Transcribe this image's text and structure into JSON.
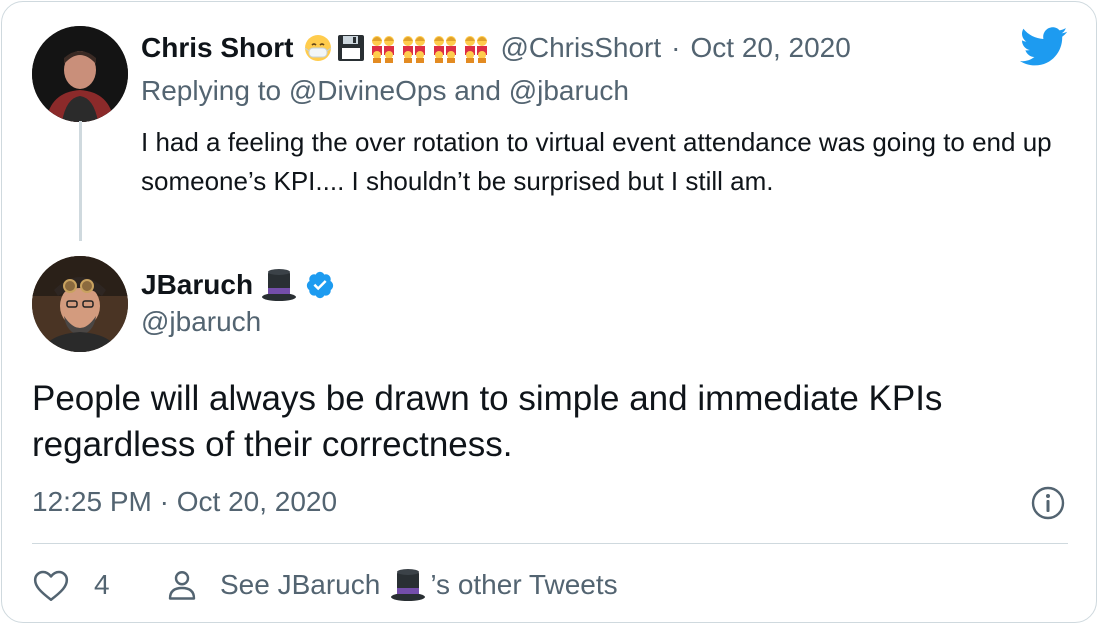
{
  "brand": {
    "accent": "#1d9bf0",
    "text": "#0f1419",
    "muted": "#536471",
    "border": "#cfd9de"
  },
  "parent_tweet": {
    "author_name": "Chris Short",
    "author_emojis": [
      "mask-face-emoji",
      "floppy-disk-emoji",
      "family-emoji",
      "family-emoji",
      "family-emoji",
      "family-emoji"
    ],
    "handle": "@ChrisShort",
    "separator": "·",
    "date": "Oct 20, 2020",
    "replying_to": "Replying to @DivineOps and @jbaruch",
    "text": "I had a feeling the over rotation to virtual event attendance was going to end up someone’s KPI.... I shouldn’t be surprised but I still am."
  },
  "main_tweet": {
    "author_name": "JBaruch",
    "author_emoji": "top-hat-emoji",
    "verified": true,
    "handle": "@jbaruch",
    "text": "People will always be drawn to simple and immediate KPIs regardless of their correctness.",
    "timestamp": "12:25 PM · Oct 20, 2020"
  },
  "actions": {
    "like_count": "4",
    "see_other_prefix": "See JBaruch",
    "see_other_suffix": "’s other Tweets"
  },
  "icons": {
    "logo": "twitter-bird-icon",
    "info": "info-icon",
    "like": "heart-icon",
    "profile": "person-icon",
    "verified": "verified-badge-icon"
  }
}
